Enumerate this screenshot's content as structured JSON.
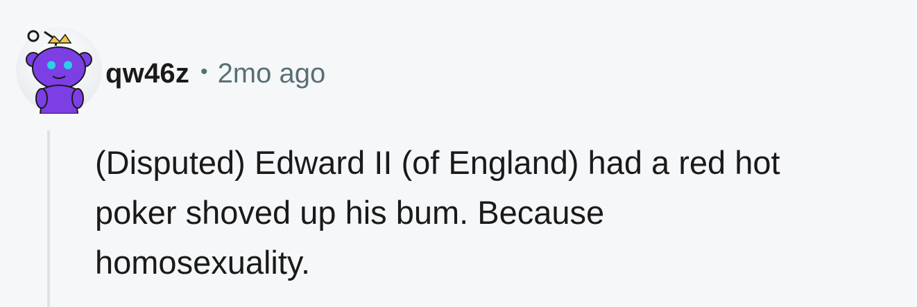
{
  "comment": {
    "author": "qw46z",
    "separator": "•",
    "timestamp": "2mo ago",
    "body_lines": [
      "(Disputed) Edward II (of England) had a red hot",
      "poker shoved up his bum. Because",
      "homosexuality."
    ]
  },
  "avatar": {
    "icon": "snoo-avatar-icon",
    "colors": {
      "background": "#ffffff",
      "body": "#7b3fe4",
      "eyes": "#2ad1e6",
      "crown": "#f5c542"
    }
  },
  "colors": {
    "background": "#f6f7f8",
    "text": "#1a1a1b",
    "meta": "#576f76",
    "thread_line": "#dde3e6"
  }
}
